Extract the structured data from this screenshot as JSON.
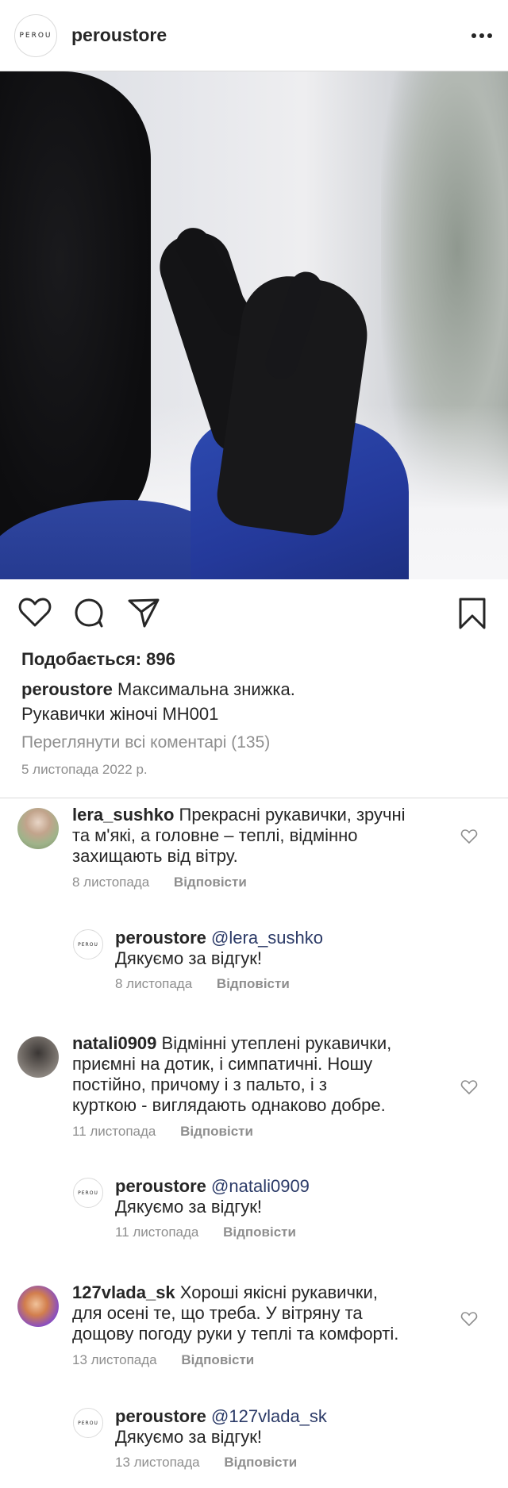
{
  "header": {
    "brand_logo_text": "PEROU",
    "username": "peroustore"
  },
  "post": {
    "likes_text": "Подобається: 896",
    "caption_user": "peroustore",
    "caption_line1": "Максимальна знижка.",
    "caption_line2": "Рукавички жіночі MH001",
    "view_all_comments": "Переглянути всі коментарі (135)",
    "date": "5 листопада 2022 р."
  },
  "comments": [
    {
      "user": "lera_sushko",
      "text_lines": [
        "Прекрасні рукавички, зручні",
        "та м'які, а головне – теплі, відмінно",
        "захищають від вітру."
      ],
      "first_line_text": "Прекрасні рукавички, зручні",
      "date": "8 листопада",
      "reply_label": "Відповісти",
      "avatar_color": "#b9c3a6",
      "reply": {
        "user": "peroustore",
        "mention": "@lera_sushko",
        "text": "Дякуємо за відгук!",
        "date": "8 листопада",
        "reply_label": "Відповісти"
      }
    },
    {
      "user": "natali0909",
      "text_lines": [
        "Відмінні утеплені рукавички,",
        "приємні на дотик, і симпатичні. Ношу",
        "постійно, причому і з пальто, і з",
        "курткою - виглядають однаково добре."
      ],
      "date": "11 листопада",
      "reply_label": "Відповісти",
      "avatar_color": "#8a8580",
      "reply": {
        "user": "peroustore",
        "mention": "@natali0909",
        "text": "Дякуємо за відгук!",
        "date": "11 листопада",
        "reply_label": "Відповісти"
      }
    },
    {
      "user": "127vlada_sk",
      "text_lines": [
        "Хороші якісні рукавички,",
        "для осені те, що треба. У вітряну та",
        "дощову погоду руки у теплі та комфорті."
      ],
      "date": "13 листопада",
      "reply_label": "Відповісти",
      "avatar_color": "#7b4fb0",
      "reply": {
        "user": "peroustore",
        "mention": "@127vlada_sk",
        "text": "Дякуємо за відгук!",
        "date": "13 листопада",
        "reply_label": "Відповісти"
      }
    }
  ],
  "icons": [
    "more-icon",
    "heart-icon",
    "comment-icon",
    "share-icon",
    "bookmark-icon",
    "small-heart-icon"
  ]
}
